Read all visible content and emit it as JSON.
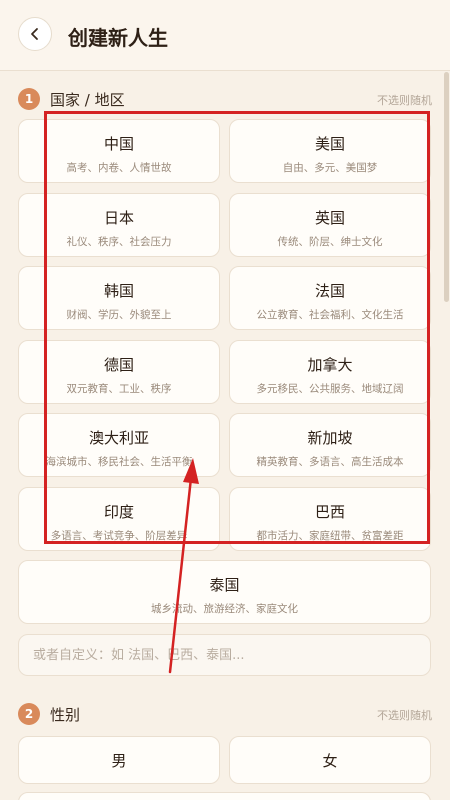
{
  "header": {
    "title": "创建新人生",
    "back_icon": "chevron-left-icon"
  },
  "country_section": {
    "step": "1",
    "title": "国家 / 地区",
    "hint": "不选则随机",
    "options": [
      {
        "name": "中国",
        "desc": "高考、内卷、人情世故"
      },
      {
        "name": "美国",
        "desc": "自由、多元、美国梦"
      },
      {
        "name": "日本",
        "desc": "礼仪、秩序、社会压力"
      },
      {
        "name": "英国",
        "desc": "传统、阶层、绅士文化"
      },
      {
        "name": "韩国",
        "desc": "财阀、学历、外貌至上"
      },
      {
        "name": "法国",
        "desc": "公立教育、社会福利、文化生活"
      },
      {
        "name": "德国",
        "desc": "双元教育、工业、秩序"
      },
      {
        "name": "加拿大",
        "desc": "多元移民、公共服务、地域辽阔"
      },
      {
        "name": "澳大利亚",
        "desc": "海滨城市、移民社会、生活平衡"
      },
      {
        "name": "新加坡",
        "desc": "精英教育、多语言、高生活成本"
      },
      {
        "name": "印度",
        "desc": "多语言、考试竞争、阶层差异"
      },
      {
        "name": "巴西",
        "desc": "都市活力、家庭纽带、贫富差距"
      },
      {
        "name": "泰国",
        "desc": "城乡流动、旅游经济、家庭文化"
      }
    ],
    "custom_placeholder": "或者自定义：如 法国、巴西、泰国..."
  },
  "gender_section": {
    "step": "2",
    "title": "性别",
    "hint": "不选则随机",
    "options": [
      "男",
      "女"
    ]
  },
  "annotation": {
    "highlight_color": "#d42222"
  }
}
